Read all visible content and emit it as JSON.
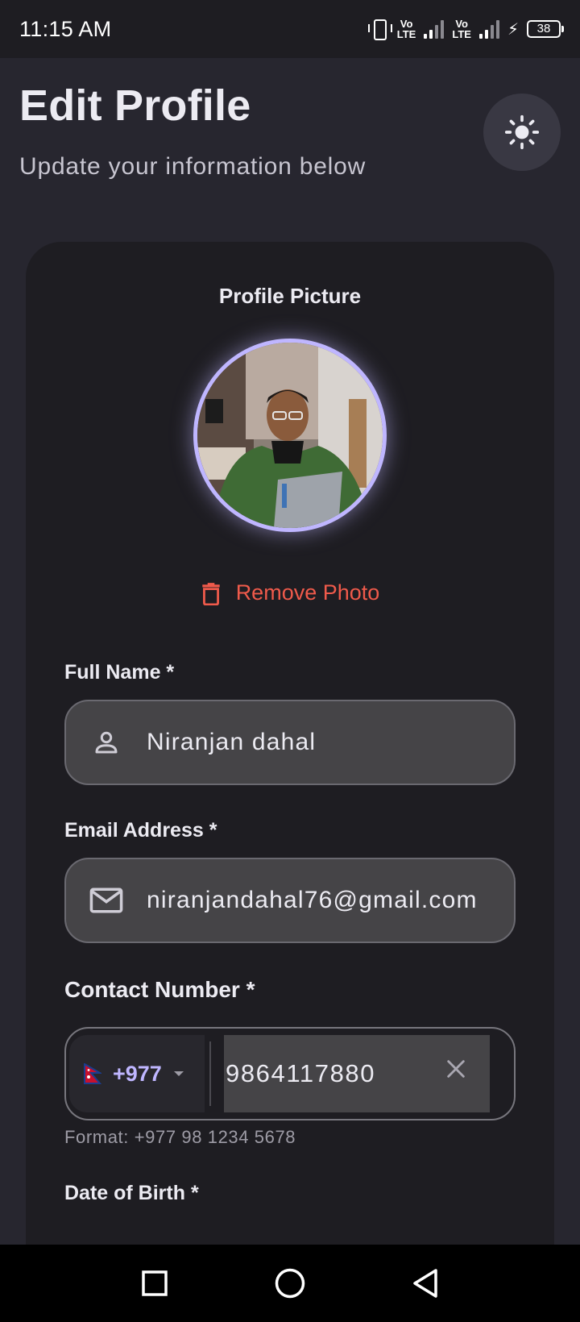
{
  "status_bar": {
    "time": "11:15 AM",
    "network_1": "Vo\nLTE",
    "network_2": "Vo\nLTE",
    "battery": "38"
  },
  "header": {
    "title": "Edit Profile",
    "subtitle": "Update your information below",
    "theme_icon": "sun-icon"
  },
  "profile": {
    "section_title": "Profile Picture",
    "remove_label": "Remove Photo"
  },
  "form": {
    "full_name": {
      "label": "Full Name *",
      "value": "Niranjan dahal"
    },
    "email": {
      "label": "Email Address *",
      "value": "niranjandahal76@gmail.com"
    },
    "contact": {
      "label": "Contact Number *",
      "country_code": "+977",
      "number": "9864117880",
      "helper": "Format: +977 98 1234 5678"
    },
    "dob_label": "Date of Birth *"
  },
  "colors": {
    "accent": "#bfb6ff",
    "danger": "#ef5a4b",
    "background": "#27262f",
    "card": "#1e1d22"
  }
}
